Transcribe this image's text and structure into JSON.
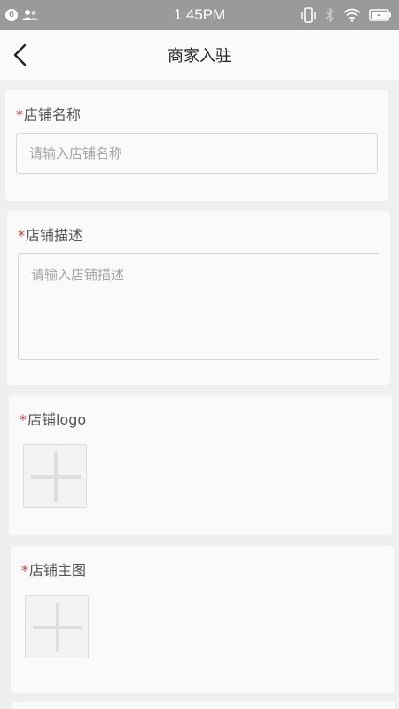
{
  "status_bar": {
    "notification_count": "6",
    "time": "1:45PM"
  },
  "header": {
    "title": "商家入驻",
    "back_icon": "chevron-left-icon"
  },
  "form": {
    "shop_name": {
      "required_mark": "*",
      "label": "店铺名称",
      "value": "",
      "placeholder": "请输入店铺名称"
    },
    "shop_description": {
      "required_mark": "*",
      "label": "店铺描述",
      "value": "",
      "placeholder": "请输入店铺描述"
    },
    "shop_logo": {
      "required_mark": "*",
      "label": "店铺logo",
      "upload_icon": "plus-icon"
    },
    "shop_main_image": {
      "required_mark": "*",
      "label": "店铺主图",
      "upload_icon": "plus-icon"
    }
  },
  "colors": {
    "status_bar_bg": "#9a9a9a",
    "page_bg": "#efefef",
    "card_bg": "#fafafa",
    "required_mark": "#d23a3a"
  }
}
